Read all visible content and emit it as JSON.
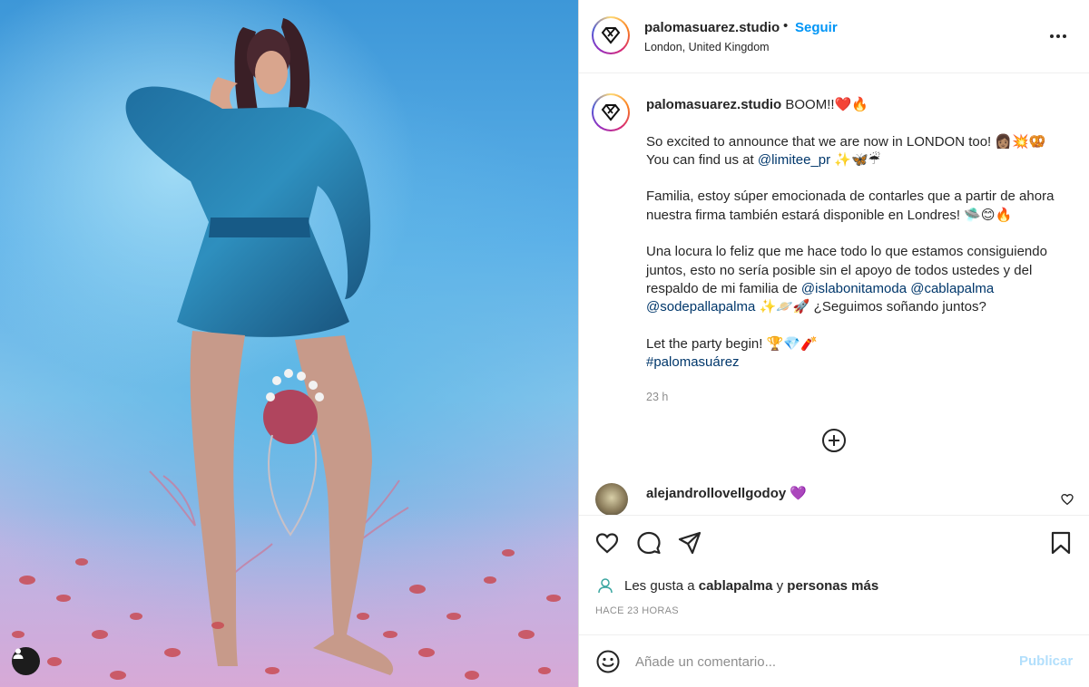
{
  "colors": {
    "link_blue": "#0095f6",
    "mention_blue": "#00376b",
    "text_primary": "#262626",
    "text_secondary": "#8e8e8e",
    "post_disabled": "#b2dffc",
    "verified_purple": "#8e44ff"
  },
  "header": {
    "username": "palomasuarez.studio",
    "separator": "•",
    "follow_label": "Seguir",
    "location": "London, United Kingdom",
    "more_icon": "more-horizontal-icon"
  },
  "caption": {
    "username": "palomasuarez.studio",
    "headline": "BOOM!!❤️🔥",
    "p1_a": "So excited to announce that we are now in LONDON too! 👩🏽💥🥨",
    "p1_b": "You can find us at ",
    "p1_mention": "@limitee_pr",
    "p1_c": " ✨🦋☔",
    "p2": "Familia, estoy súper emocionada de contarles que a partir de ahora nuestra firma también estará disponible en Londres! 🛸😊🔥",
    "p3_a": "Una locura lo feliz que me hace todo lo que estamos consiguiendo juntos, esto no sería posible sin el apoyo de todos ustedes y del respaldo de mi familia de ",
    "p3_m1": "@islabonitamoda",
    "p3_m2": "@cablapalma",
    "p3_m3": "@sodepallapalma",
    "p3_b": " ✨🪐🚀 ¿Seguimos soñando juntos?",
    "p4_a": "Let the party begin! 🏆💎🧨",
    "p4_hashtag": "#palomasuárez",
    "time": "23 h"
  },
  "comment": {
    "username": "alejandrollovellgodoy",
    "emoji": "💜"
  },
  "likes": {
    "prefix": "Les gusta a ",
    "user": "cablapalma",
    "middle": " y ",
    "others": "personas más"
  },
  "timestamp": "HACE 23 HORAS",
  "comment_input": {
    "placeholder": "Añade un comentario...",
    "post_label": "Publicar"
  }
}
